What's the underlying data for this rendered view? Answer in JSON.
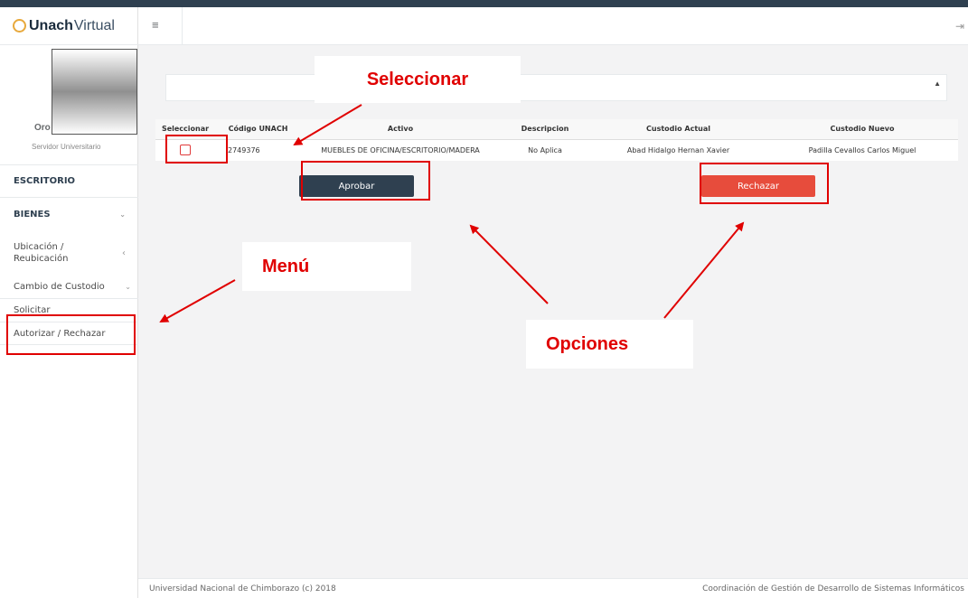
{
  "brand": {
    "bold": "Unach",
    "light": "Virtual"
  },
  "user": {
    "name": "Oro",
    "role": "Servidor Universitario"
  },
  "sidebar": {
    "items": [
      {
        "label": "ESCRITORIO"
      },
      {
        "label": "BIENES"
      },
      {
        "label": "Ubicación / Reubicación"
      },
      {
        "label": "Cambio de Custodio"
      },
      {
        "label": "Solicitar"
      },
      {
        "label": "Autorizar / Rechazar"
      }
    ]
  },
  "header": {
    "menu_icon": "hamburger-icon",
    "logout_icon": "logout-icon"
  },
  "table": {
    "headers": [
      "Seleccionar",
      "Código UNACH",
      "Activo",
      "Descripcion",
      "Custodio Actual",
      "Custodio Nuevo"
    ],
    "rows": [
      {
        "codigo": "2749376",
        "activo": "MUEBLES DE OFICINA/ESCRITORIO/MADERA",
        "descripcion": "No Aplica",
        "actual": "Abad Hidalgo Hernan Xavier",
        "nuevo": "Padilla Cevallos Carlos Miguel"
      }
    ]
  },
  "buttons": {
    "approve": "Aprobar",
    "reject": "Rechazar"
  },
  "callouts": {
    "select": "Seleccionar",
    "menu": "Menú",
    "options": "Opciones"
  },
  "footer": {
    "left": "Universidad Nacional de Chimborazo (c) 2018",
    "right": "Coordinación de Gestión de Desarrollo de Sistemas Informáticos"
  },
  "colors": {
    "dark": "#2f4050",
    "danger": "#e74c3c",
    "annotation": "#e00000"
  }
}
